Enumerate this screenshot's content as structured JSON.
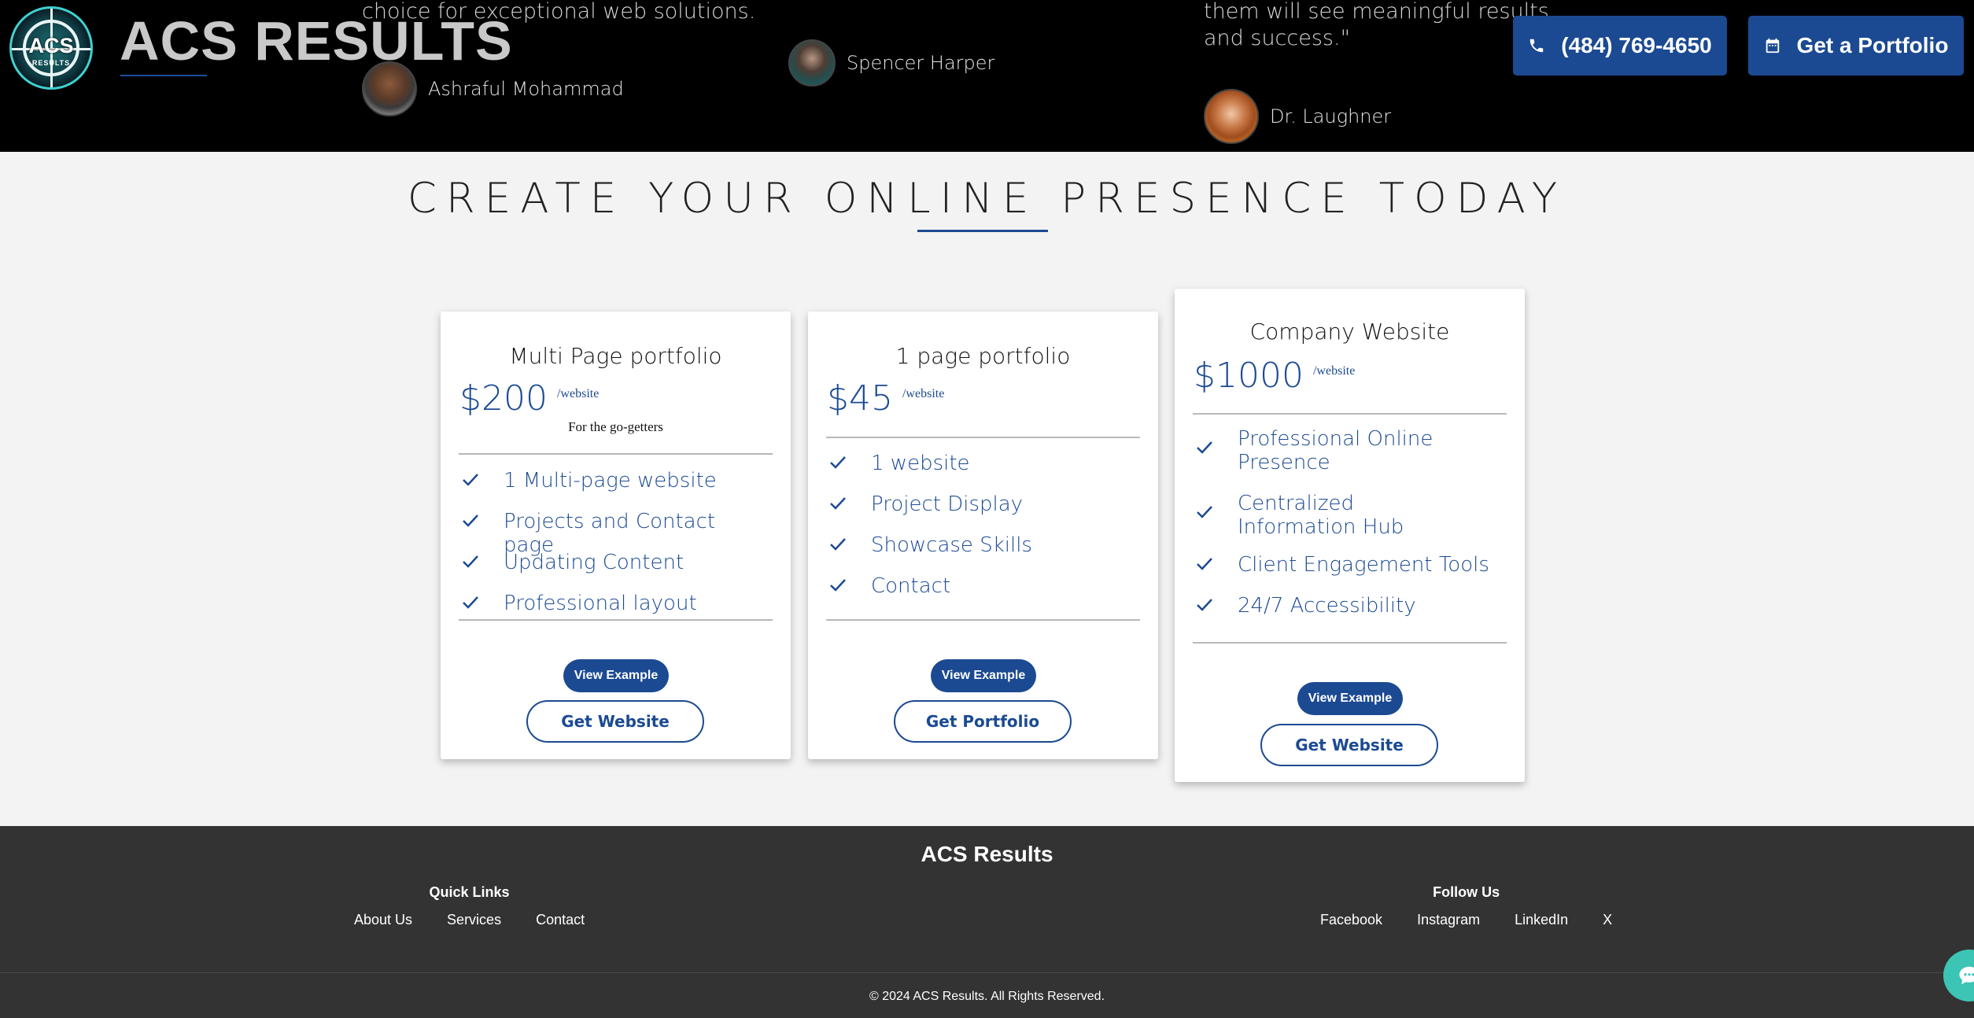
{
  "header": {
    "logo_text": "ACS",
    "logo_subtext": "RESULTS",
    "brand": "ACS RESULTS",
    "testimonials": [
      {
        "text": "choice for exceptional web solutions.",
        "name": "Ashraful Mohammad"
      },
      {
        "text": "",
        "name": "Spencer Harper"
      },
      {
        "text": "them will see meaningful results and success.\"",
        "name": "Dr. Laughner"
      }
    ],
    "phone_label": "(484) 769-4650",
    "portfolio_label": "Get a Portfolio"
  },
  "section": {
    "title": "CREATE YOUR ONLINE PRESENCE TODAY"
  },
  "plans": [
    {
      "title": "Multi Page portfolio",
      "price": "$200",
      "per": "/website",
      "tagline": "For the go-getters",
      "features": [
        "1 Multi-page website",
        "Projects and Contact page",
        "Updating Content",
        "Professional layout"
      ],
      "view_label": "View Example",
      "action_label": "Get Website"
    },
    {
      "title": "1 page portfolio",
      "price": "$45",
      "per": "/website",
      "features": [
        "1 website",
        "Project Display",
        "Showcase Skills",
        "Contact"
      ],
      "view_label": "View Example",
      "action_label": "Get Portfolio"
    },
    {
      "title": "Company Website",
      "price": "$1000",
      "per": "/website",
      "features": [
        "Professional Online Presence",
        "Centralized Information Hub",
        "Client Engagement Tools",
        "24/7 Accessibility"
      ],
      "view_label": "View Example",
      "action_label": "Get Website"
    }
  ],
  "footer": {
    "title": "ACS Results",
    "quick_links_heading": "Quick Links",
    "quick_links": [
      "About Us",
      "Services",
      "Contact"
    ],
    "follow_heading": "Follow Us",
    "social_links": [
      "Facebook",
      "Instagram",
      "LinkedIn",
      "X"
    ],
    "copyright": "© 2024 ACS Results. All Rights Reserved."
  },
  "colors": {
    "accent": "#1b4a92",
    "header_bg": "#000000",
    "footer_bg": "#333333",
    "chat": "#3cc4b4"
  },
  "icons": {
    "phone": "phone-icon",
    "portfolio": "calendar-icon",
    "check": "check-icon",
    "chat": "chat-icon"
  }
}
